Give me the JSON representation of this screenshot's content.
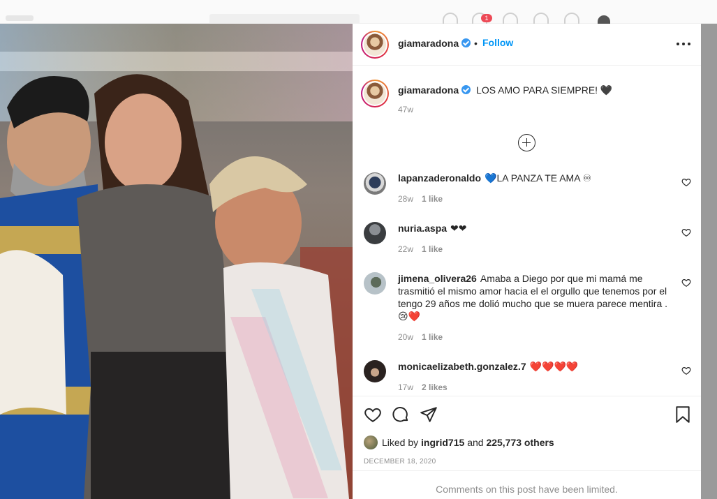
{
  "topbar": {
    "notification_count": "1"
  },
  "post": {
    "author": "giamaradona",
    "follow_label": "Follow",
    "separator": "•",
    "caption": "LOS AMO PARA SIEMPRE! 🖤",
    "caption_time": "47w",
    "comments": [
      {
        "username": "lapanzaderonaldo",
        "text": "💙LA PANZA TE AMA ♾",
        "time": "28w",
        "likes": "1 like"
      },
      {
        "username": "nuria.aspa",
        "text": "❤❤",
        "time": "22w",
        "likes": "1 like"
      },
      {
        "username": "jimena_olivera26",
        "text": "Amaba a Diego por que mi mamá me trasmitió el mismo amor hacia el el orgullo que tenemos por el tengo 29 años me dolió mucho que se muera parece mentira .😢❤️",
        "time": "20w",
        "likes": "1 like"
      },
      {
        "username": "monicaelizabeth.gonzalez.7",
        "text": "❤️❤️❤️❤️",
        "time": "17w",
        "likes": "2 likes"
      }
    ],
    "liked_by_prefix": "Liked by",
    "liked_by_user": "ingrid715",
    "liked_by_and": "and",
    "liked_by_count": "225,773 others",
    "date": "DECEMBER 18, 2020",
    "comments_limited": "Comments on this post have been limited."
  },
  "colors": {
    "link_blue": "#0095f6",
    "verified": "#3897f0",
    "muted": "#8e8e8e",
    "text": "#262626"
  },
  "icons": [
    "verified-icon",
    "more-icon",
    "load-more-icon",
    "heart-icon",
    "comment-icon",
    "share-icon",
    "bookmark-icon"
  ]
}
